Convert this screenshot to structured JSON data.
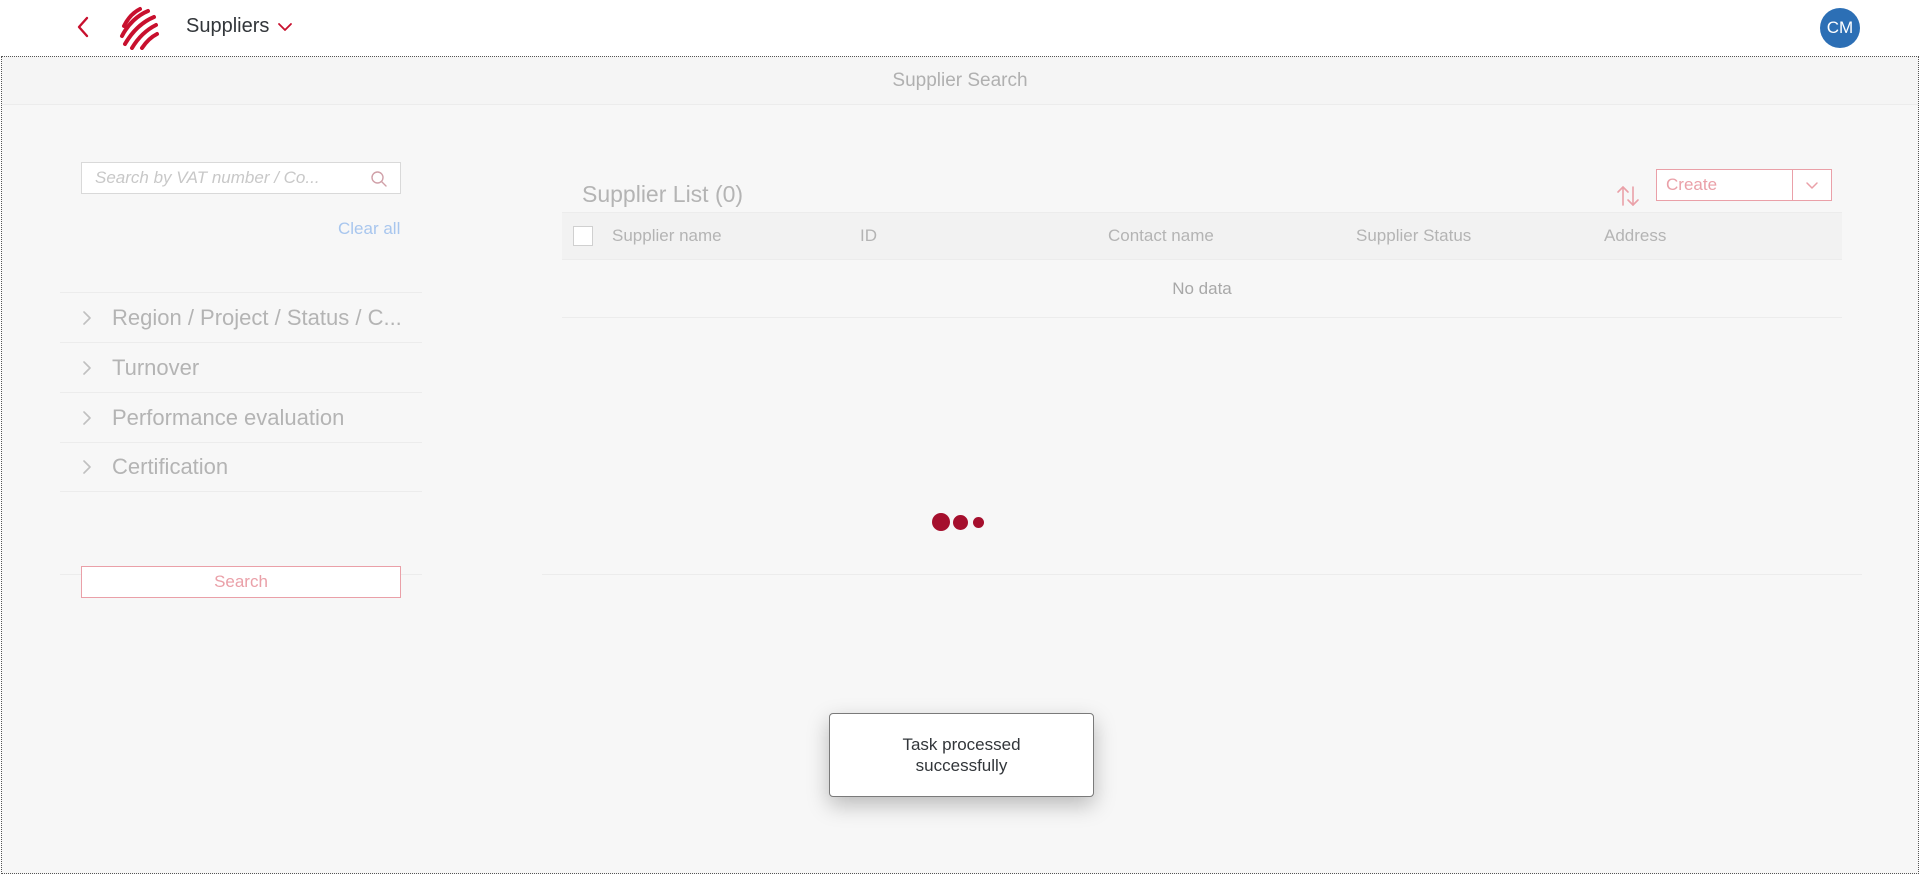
{
  "header": {
    "title": "Suppliers",
    "avatar_initials": "CM",
    "brand_color": "#c8102e",
    "avatar_color": "#2c6fb5"
  },
  "page": {
    "subheader_title": "Supplier Search"
  },
  "filters": {
    "search_placeholder": "Search by VAT number / Co...",
    "clear_all_label": "Clear all",
    "sections": [
      {
        "label": "Region / Project / Status / C..."
      },
      {
        "label": "Turnover"
      },
      {
        "label": "Performance evaluation"
      },
      {
        "label": "Certification"
      }
    ],
    "search_button_label": "Search"
  },
  "list": {
    "title": "Supplier List (0)",
    "create_label": "Create",
    "columns": [
      "Supplier name",
      "ID",
      "Contact name",
      "Supplier Status",
      "Address"
    ],
    "empty_text": "No data"
  },
  "busy_indicator": {
    "color": "#a50f2d"
  },
  "toast": {
    "message": "Task processed successfully"
  }
}
